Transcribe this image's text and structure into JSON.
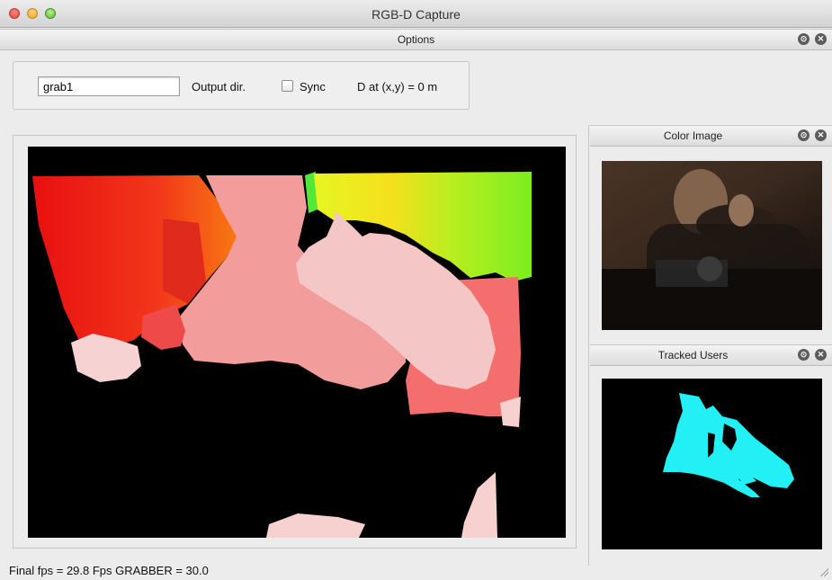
{
  "window": {
    "title": "RGB-D Capture"
  },
  "options_panel": {
    "title": "Options",
    "output_dir_value": "grab1",
    "output_dir_label": "Output dir.",
    "sync_label": "Sync",
    "sync_checked": false,
    "distance_readout": "D at (x,y) = 0 m"
  },
  "color_panel": {
    "title": "Color Image"
  },
  "users_panel": {
    "title": "Tracked Users"
  },
  "status": {
    "text": "Final fps = 29.8 Fps GRABBER = 30.0"
  },
  "colors": {
    "background": "#ececec",
    "depth_red": "#f01a14",
    "depth_orange": "#f76f0f",
    "depth_pink": "#f4a0a2",
    "depth_light_pink": "#f6cccc",
    "depth_yellow": "#eef22a",
    "depth_green": "#88ef22",
    "user_cyan": "#22f0f4"
  }
}
